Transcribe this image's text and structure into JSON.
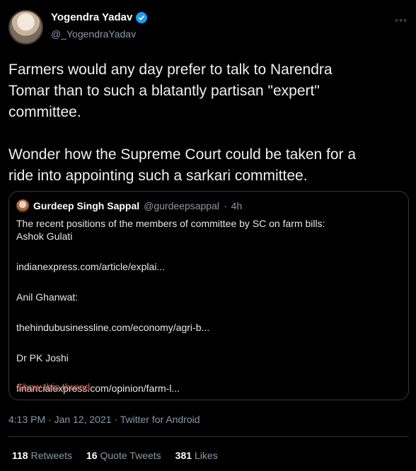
{
  "author": {
    "name": "Yogendra Yadav",
    "handle": "@_YogendraYadav"
  },
  "more_glyph": "◦◦◦",
  "tweet_text": {
    "line1": "Farmers would any day prefer to talk to Narendra",
    "line2": "Tomar than to such a blatantly partisan \"expert\"",
    "line3": "committee.",
    "line4": "Wonder how the Supreme Court could be taken for a",
    "line5": "ride into appointing such a sarkari committee."
  },
  "quoted": {
    "name": "Gurdeep Singh Sappal",
    "handle": "@gurdeepsappal",
    "separator": "·",
    "time": "4h",
    "lines": [
      "The recent positions of the members of committee by SC on farm bills:",
      "Ashok Gulati",
      "indianexpress.com/article/explai...",
      "Anil Ghanwat:",
      "thehindubusinessline.com/economy/agri-b...",
      "Dr PK Joshi",
      "financialexpress.com/opinion/farm-l..."
    ],
    "show_thread": "Show this thread"
  },
  "meta": "4:13 PM · Jan 12, 2021 · Twitter for Android",
  "stats": {
    "retweets": {
      "count": "118",
      "label": "Retweets"
    },
    "quotes": {
      "count": "16",
      "label": "Quote Tweets"
    },
    "likes": {
      "count": "381",
      "label": "Likes"
    }
  },
  "colors": {
    "background": "#000000",
    "link": "#e0553f",
    "secondary_text": "#8b98a5",
    "verified": "#1d9bf0"
  }
}
